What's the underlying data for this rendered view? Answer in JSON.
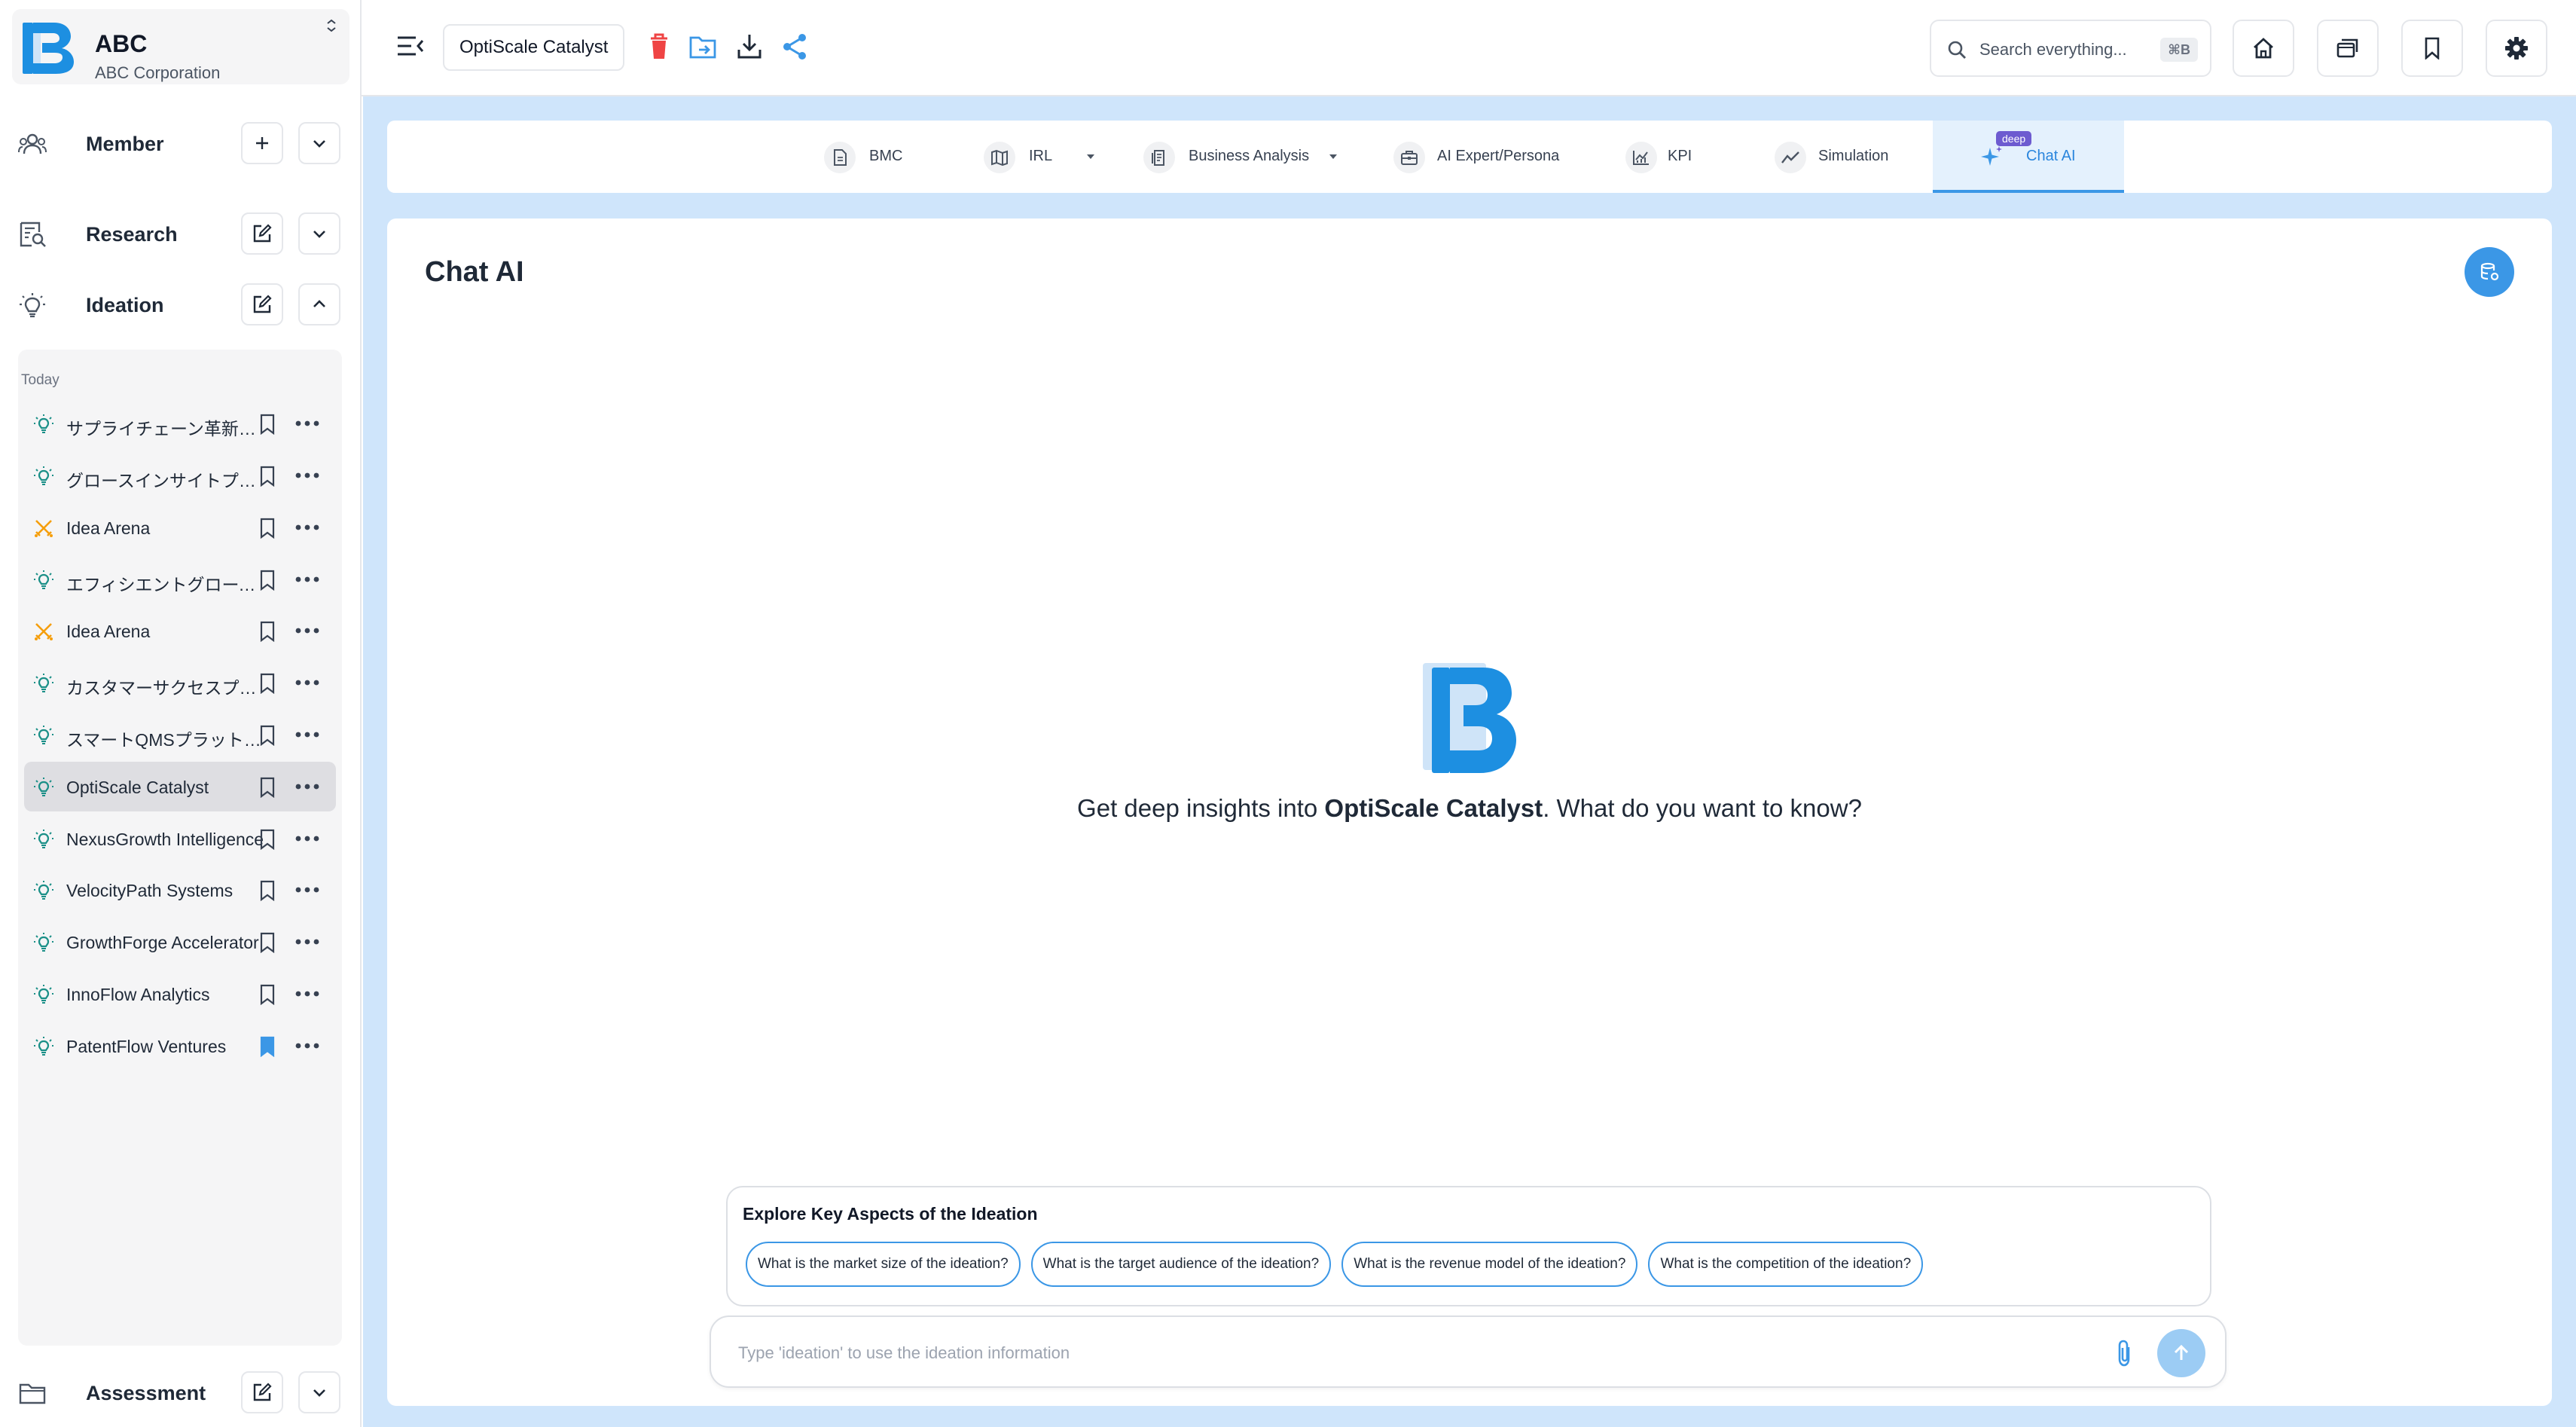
{
  "org": {
    "logo_letter": "B",
    "name": "ABC",
    "subtitle": "ABC Corporation"
  },
  "sidebar": {
    "sections": {
      "member": {
        "label": "Member"
      },
      "research": {
        "label": "Research"
      },
      "ideation": {
        "label": "Ideation"
      },
      "assessment": {
        "label": "Assessment"
      }
    },
    "group_label": "Today",
    "items": [
      {
        "label": "サプライチェーン革新ソリューション",
        "icon": "lightbulb-icon",
        "bookmarked": false,
        "selected": false
      },
      {
        "label": "グロースインサイトプラットフォーム",
        "icon": "lightbulb-icon",
        "bookmarked": false,
        "selected": false
      },
      {
        "label": "Idea Arena",
        "icon": "crossed-swords-icon",
        "bookmarked": false,
        "selected": false
      },
      {
        "label": "エフィシエントグロースシステム",
        "icon": "lightbulb-icon",
        "bookmarked": false,
        "selected": false
      },
      {
        "label": "Idea Arena",
        "icon": "crossed-swords-icon",
        "bookmarked": false,
        "selected": false
      },
      {
        "label": "カスタマーサクセスプラットフォーム",
        "icon": "lightbulb-icon",
        "bookmarked": false,
        "selected": false
      },
      {
        "label": "スマートQMSプラットフォーム",
        "icon": "lightbulb-icon",
        "bookmarked": false,
        "selected": false
      },
      {
        "label": "OptiScale Catalyst",
        "icon": "lightbulb-icon",
        "bookmarked": false,
        "selected": true
      },
      {
        "label": "NexusGrowth Intelligence",
        "icon": "lightbulb-icon",
        "bookmarked": false,
        "selected": false
      },
      {
        "label": "VelocityPath Systems",
        "icon": "lightbulb-icon",
        "bookmarked": false,
        "selected": false
      },
      {
        "label": "GrowthForge Accelerator",
        "icon": "lightbulb-icon",
        "bookmarked": false,
        "selected": false
      },
      {
        "label": "InnoFlow Analytics",
        "icon": "lightbulb-icon",
        "bookmarked": false,
        "selected": false
      },
      {
        "label": "PatentFlow Ventures",
        "icon": "lightbulb-icon",
        "bookmarked": true,
        "selected": false
      }
    ]
  },
  "topbar": {
    "title": "OptiScale Catalyst",
    "search_placeholder": "Search everything...",
    "search_shortcut": "⌘B"
  },
  "tabs": [
    {
      "label": "BMC",
      "icon": "document-icon",
      "dropdown": false,
      "active": false
    },
    {
      "label": "IRL",
      "icon": "map-icon",
      "dropdown": true,
      "active": false
    },
    {
      "label": "Business Analysis",
      "icon": "report-icon",
      "dropdown": true,
      "active": false
    },
    {
      "label": "AI Expert/Persona",
      "icon": "briefcase-icon",
      "dropdown": false,
      "active": false
    },
    {
      "label": "KPI",
      "icon": "chart-icon",
      "dropdown": false,
      "active": false
    },
    {
      "label": "Simulation",
      "icon": "trend-icon",
      "dropdown": false,
      "active": false
    },
    {
      "label": "Chat AI",
      "icon": "sparkle-icon",
      "dropdown": false,
      "active": true,
      "badge": "deep"
    }
  ],
  "chat": {
    "title": "Chat AI",
    "hero_prefix": "Get deep insights into ",
    "hero_subject": "OptiScale Catalyst",
    "hero_suffix": ". What do you want to know?",
    "explore_title": "Explore Key Aspects of the Ideation",
    "suggestions": [
      "What is the market size of the ideation?",
      "What is the target audience of the ideation?",
      "What is the revenue model of the ideation?",
      "What is the competition of the ideation?"
    ],
    "input_placeholder": "Type 'ideation' to use the ideation information"
  },
  "colors": {
    "accent": "#3b97e6",
    "teal_icon": "#1a8f87",
    "arena_icon": "#f59e0b",
    "delete_red": "#ef4444",
    "main_bg": "#cfe5fb"
  }
}
